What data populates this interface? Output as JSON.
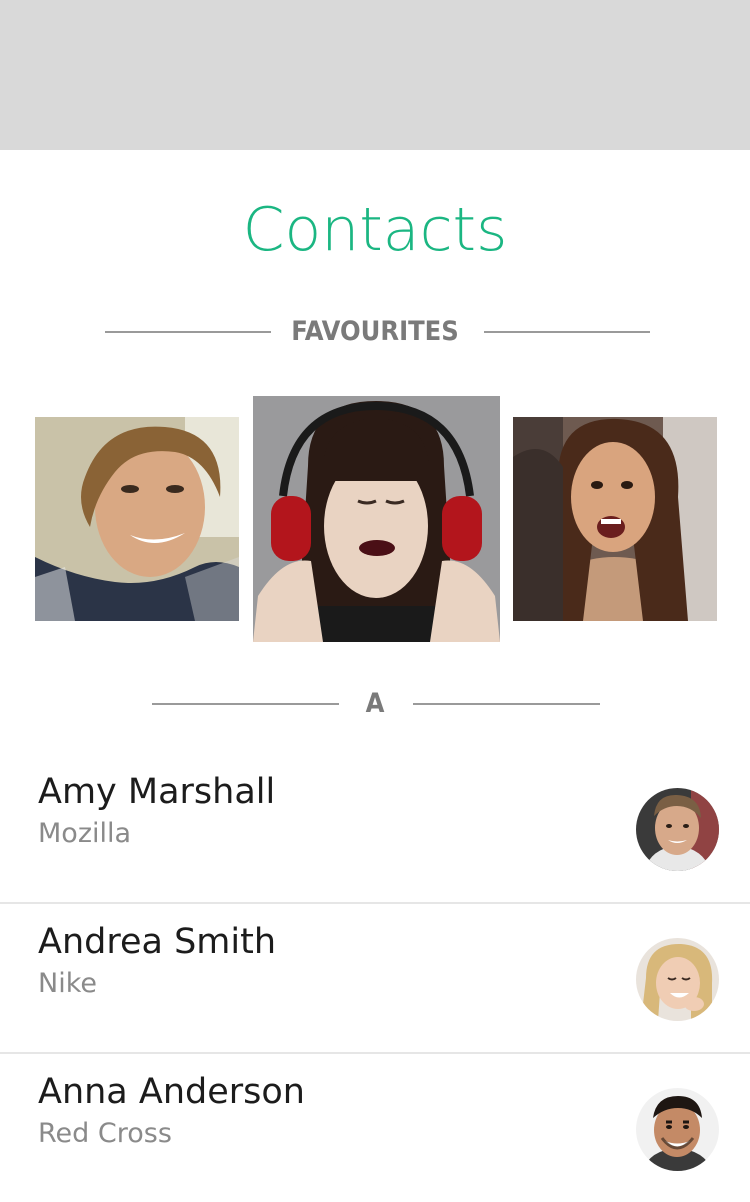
{
  "header": {
    "title": "Contacts"
  },
  "favourites": {
    "heading": "FAVOURITES",
    "photos": [
      {
        "alt": "favourite-contact-1"
      },
      {
        "alt": "favourite-contact-2"
      },
      {
        "alt": "favourite-contact-3"
      }
    ]
  },
  "sections": [
    {
      "letter": "A",
      "contacts": [
        {
          "name": "Amy Marshall",
          "company": "Mozilla"
        },
        {
          "name": "Andrea Smith",
          "company": "Nike"
        },
        {
          "name": "Anna Anderson",
          "company": "Red Cross"
        }
      ]
    }
  ],
  "colors": {
    "accent": "#1bb682",
    "status_bar": "#d9d9d9",
    "divider": "#e6e6e6",
    "rule": "#9a9a9a",
    "name_text": "#1c1c1c",
    "secondary_text": "#8a8a8a"
  }
}
